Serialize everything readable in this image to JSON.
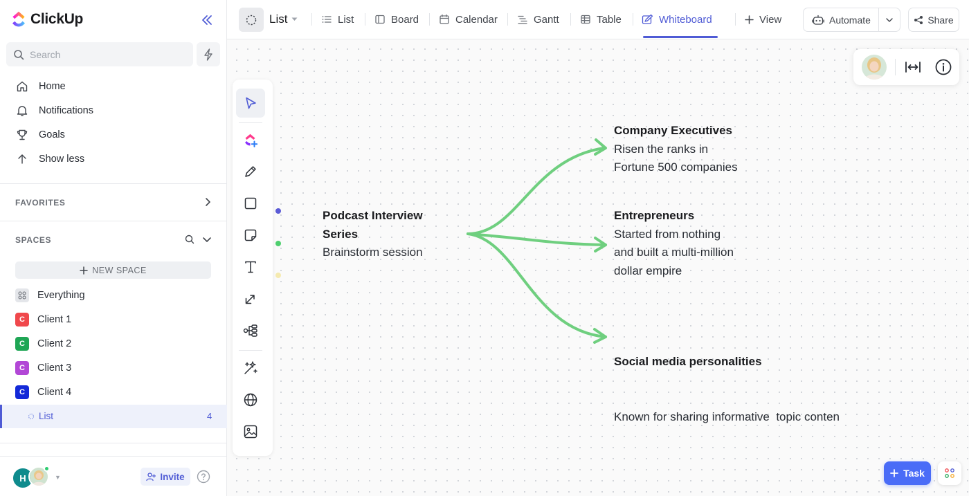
{
  "app": {
    "brand": "ClickUp"
  },
  "sidebar": {
    "search_placeholder": "Search",
    "nav": [
      {
        "label": "Home",
        "icon": "home-icon"
      },
      {
        "label": "Notifications",
        "icon": "bell-icon"
      },
      {
        "label": "Goals",
        "icon": "trophy-icon"
      },
      {
        "label": "Show less",
        "icon": "arrow-up-icon"
      }
    ],
    "favorites_title": "FAVORITES",
    "spaces_title": "SPACES",
    "new_space_label": "NEW SPACE",
    "spaces": [
      {
        "label": "Everything",
        "badge": "",
        "color": "#e4e6ea"
      },
      {
        "label": "Client 1",
        "badge": "C",
        "color": "#f0484c"
      },
      {
        "label": "Client 2",
        "badge": "C",
        "color": "#1fa655"
      },
      {
        "label": "Client 3",
        "badge": "C",
        "color": "#b247d6"
      },
      {
        "label": "Client 4",
        "badge": "C",
        "color": "#1329d8"
      }
    ],
    "active_list": {
      "label": "List",
      "count": "4"
    },
    "footer": {
      "avatar_initial": "H",
      "invite_label": "Invite"
    }
  },
  "topbar": {
    "list_title": "List",
    "views": [
      {
        "label": "List",
        "icon": "list-icon"
      },
      {
        "label": "Board",
        "icon": "board-icon"
      },
      {
        "label": "Calendar",
        "icon": "calendar-icon"
      },
      {
        "label": "Gantt",
        "icon": "gantt-icon"
      },
      {
        "label": "Table",
        "icon": "table-icon"
      },
      {
        "label": "Whiteboard",
        "icon": "whiteboard-icon",
        "active": true
      }
    ],
    "add_view_label": "View",
    "automate_label": "Automate",
    "share_label": "Share"
  },
  "whiteboard": {
    "tool_dot_colors": [
      "#5b5bd6",
      "#4fcf6f",
      "#f5eab0"
    ],
    "arrow_color": "#6fcf7f",
    "root": {
      "title_lines": [
        "Podcast Interview",
        "Series"
      ],
      "subtitle": "Brainstorm session"
    },
    "branches": [
      {
        "title": "Company Executives",
        "lines": [
          "Risen the ranks in",
          "Fortune 500 companies"
        ]
      },
      {
        "title": "Entrepreneurs",
        "lines": [
          "Started from nothing",
          "and built a multi-million",
          "dollar empire"
        ]
      },
      {
        "title": "Social media personalities",
        "lines": [
          "Known for sharing informative  topic conten"
        ]
      }
    ]
  },
  "floating": {
    "task_label": "Task"
  }
}
